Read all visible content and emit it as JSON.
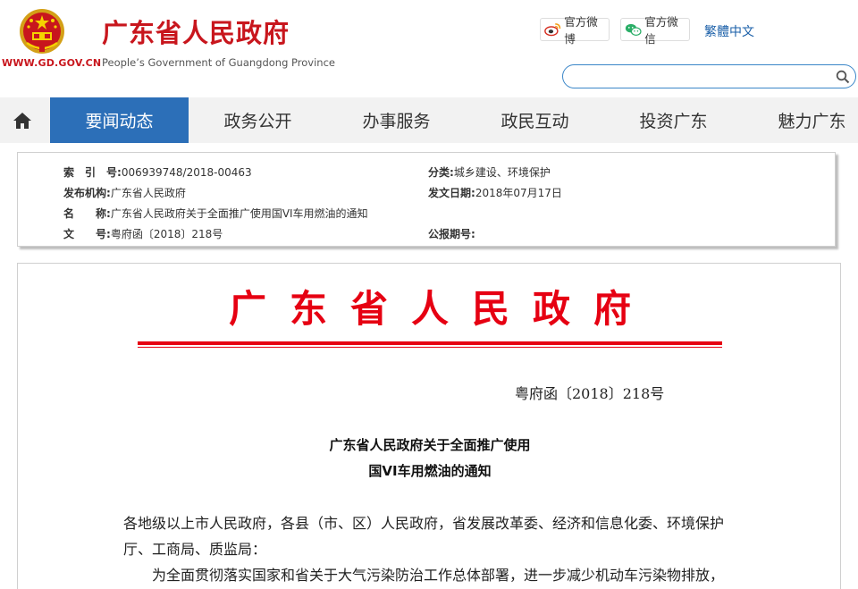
{
  "header": {
    "site_url": "WWW.GD.GOV.CN",
    "title": "广东省人民政府",
    "subtitle": "People’s Government of Guangdong Province",
    "weibo_label": "官方微博",
    "wechat_label": "官方微信",
    "language_link": "繁體中文",
    "search_placeholder": ""
  },
  "nav": {
    "items": [
      {
        "label": "要闻动态",
        "active": true
      },
      {
        "label": "政务公开",
        "active": false
      },
      {
        "label": "办事服务",
        "active": false
      },
      {
        "label": "政民互动",
        "active": false
      },
      {
        "label": "投资广东",
        "active": false
      },
      {
        "label": "魅力广东",
        "active": false
      }
    ]
  },
  "meta": {
    "index_key": "索　引　号:",
    "index_value": "006939748/2018-00463",
    "category_key": "分类:",
    "category_value": "城乡建设、环境保护",
    "issuer_key": "发布机构:",
    "issuer_value": "广东省人民政府",
    "date_key": "发文日期:",
    "date_value": "2018年07月17日",
    "name_key": "名　　称:",
    "name_value": "广东省人民政府关于全面推广使用国VI车用燃油的通知",
    "docno_key": "文　　号:",
    "docno_value": "粤府函〔2018〕218号",
    "gazette_key": "公报期号:",
    "gazette_value": ""
  },
  "document": {
    "header": "广东省人民政府",
    "number": "粤府函〔2018〕218号",
    "title_line1": "广东省人民政府关于全面推广使用",
    "title_line2": "国VI车用燃油的通知",
    "salutation": "各地级以上市人民政府，各县（市、区）人民政府，省发展改革委、经济和信息化委、环境保护厅、工商局、质监局：",
    "paragraph1": "为全面贯彻落实国家和省关于大气污染防治工作总体部署，进一步减少机动车污染物排放，"
  },
  "colors": {
    "brand_red": "#c8161d",
    "doc_red": "#e60012",
    "nav_active": "#2c6fb8",
    "link_blue": "#1a5fa8"
  }
}
